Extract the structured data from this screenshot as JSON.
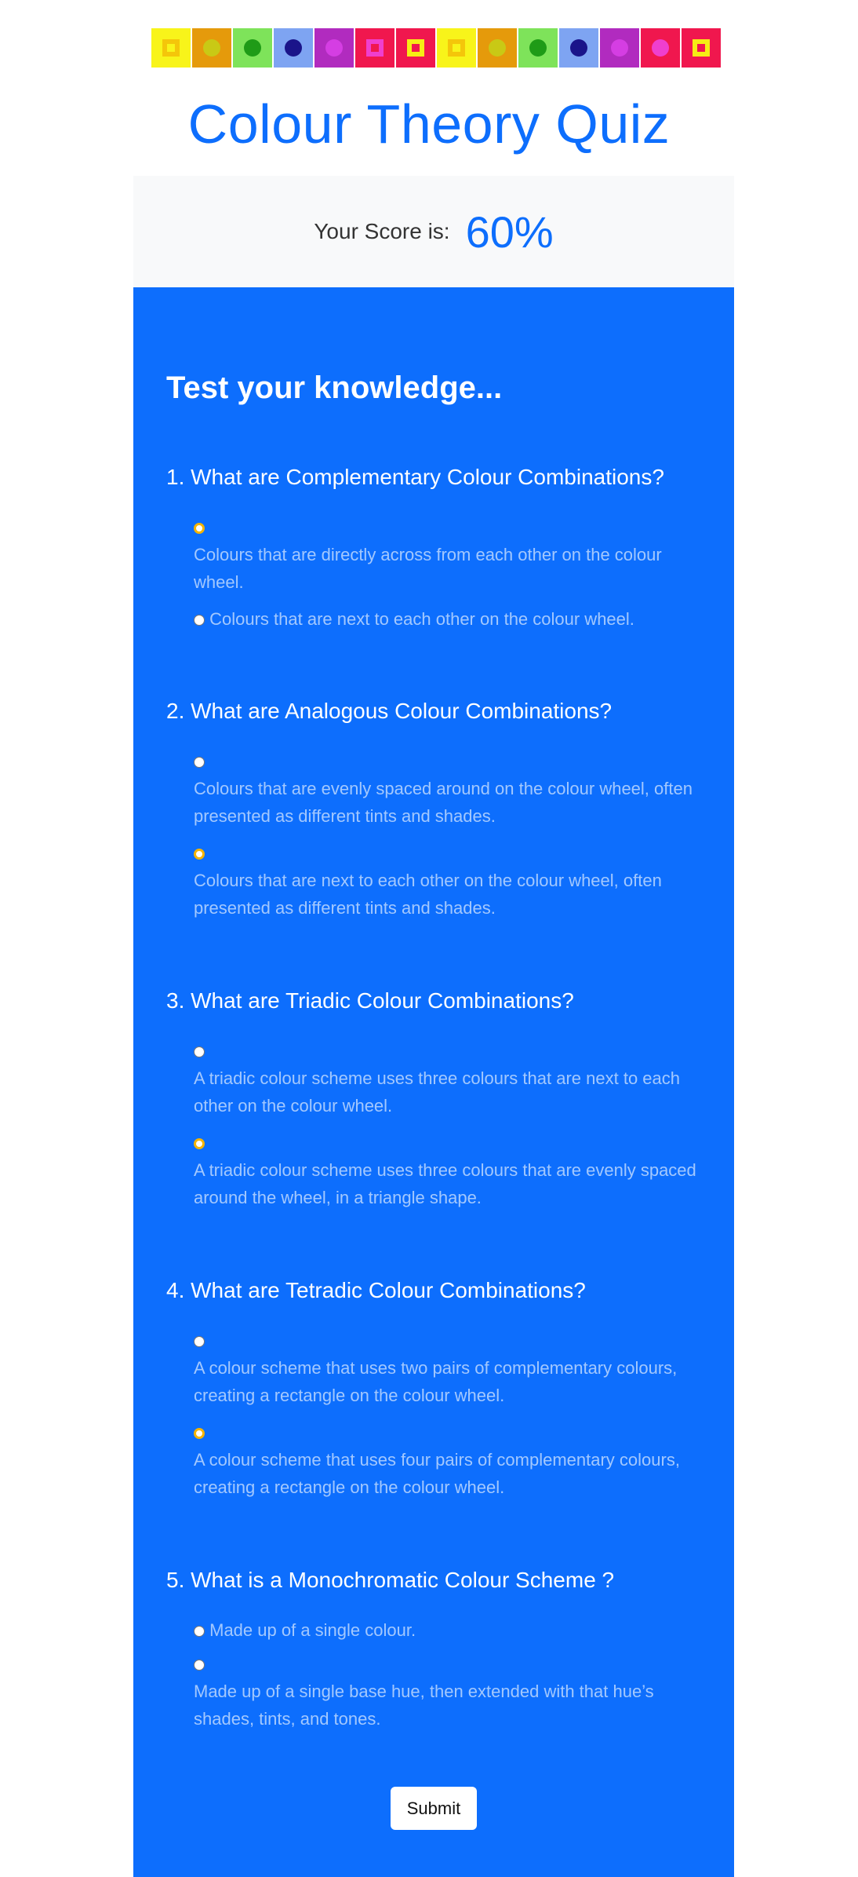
{
  "header": {
    "tiles": [
      {
        "bg": "#f8f41a",
        "inner": "#f4c60a",
        "shape": "sq",
        "name": "yellow-square-tile-icon"
      },
      {
        "bg": "#e59a0b",
        "inner": "#c9c915",
        "shape": "circ",
        "name": "orange-circle-tile-icon"
      },
      {
        "bg": "#7ee35a",
        "inner": "#1f9b17",
        "shape": "circ",
        "name": "green-circle-tile-icon"
      },
      {
        "bg": "#7ea4f2",
        "inner": "#1a148a",
        "shape": "circ",
        "name": "blue-circle-tile-icon"
      },
      {
        "bg": "#b12bbf",
        "inner": "#d53ee3",
        "shape": "circ",
        "name": "purple-circle-tile-icon"
      },
      {
        "bg": "#f0174e",
        "inner": "#ef3fcf",
        "shape": "sq",
        "name": "red-square-tile-icon"
      },
      {
        "bg": "#f0174e",
        "inner": "#f6ec15",
        "shape": "sq",
        "name": "red-yellow-square-tile-icon"
      },
      {
        "bg": "#f8f41a",
        "inner": "#f4c60a",
        "shape": "sq",
        "name": "yellow-square-tile-icon"
      },
      {
        "bg": "#e59a0b",
        "inner": "#c9c915",
        "shape": "circ",
        "name": "orange-circle-tile-icon"
      },
      {
        "bg": "#7ee35a",
        "inner": "#1f9b17",
        "shape": "circ",
        "name": "green-circle-tile-icon"
      },
      {
        "bg": "#7ea4f2",
        "inner": "#1a148a",
        "shape": "circ",
        "name": "blue-circle-tile-icon"
      },
      {
        "bg": "#b12bbf",
        "inner": "#d53ee3",
        "shape": "circ",
        "name": "purple-circle-tile-icon"
      },
      {
        "bg": "#f0174e",
        "inner": "#ef3fcf",
        "shape": "circ",
        "name": "red-circle-tile-icon"
      },
      {
        "bg": "#f0174e",
        "inner": "#f6ec15",
        "shape": "sq",
        "name": "red-yellow-square-tile-icon"
      }
    ],
    "title": "Colour Theory Quiz"
  },
  "score": {
    "label": "Your Score is:",
    "value": "60%"
  },
  "quiz": {
    "heading": "Test your knowledge...",
    "questions": [
      {
        "text": "1. What are Complementary Colour Combinations?",
        "options": [
          {
            "label": "Colours that are directly across from each other on the colour wheel.",
            "checked": true,
            "layout": "block"
          },
          {
            "label": "Colours that are next to each other on the colour wheel.",
            "checked": false,
            "layout": "inline"
          }
        ]
      },
      {
        "text": "2. What are Analogous Colour Combinations?",
        "options": [
          {
            "label": "Colours that are evenly spaced around on the colour wheel, often presented as different tints and shades.",
            "checked": false,
            "layout": "block"
          },
          {
            "label": "Colours that are next to each other on the colour wheel, often presented as different tints and shades.",
            "checked": true,
            "layout": "block"
          }
        ]
      },
      {
        "text": "3. What are Triadic Colour Combinations?",
        "options": [
          {
            "label": "A triadic colour scheme uses three colours that are next to each other on the colour wheel.",
            "checked": false,
            "layout": "block"
          },
          {
            "label": "A triadic colour scheme uses three colours that are evenly spaced around the wheel, in a triangle shape.",
            "checked": true,
            "layout": "block"
          }
        ]
      },
      {
        "text": "4. What are Tetradic Colour Combinations?",
        "options": [
          {
            "label": "A colour scheme that uses two pairs of complementary colours, creating a rectangle on the colour wheel.",
            "checked": false,
            "layout": "block"
          },
          {
            "label": "A colour scheme that uses four pairs of complementary colours, creating a rectangle on the colour wheel.",
            "checked": true,
            "layout": "block"
          }
        ]
      },
      {
        "text": "5. What is a Monochromatic Colour Scheme ?",
        "options": [
          {
            "label": "Made up of a single colour.",
            "checked": false,
            "layout": "inline"
          },
          {
            "label": "Made up of a single base hue, then extended with that hue’s shades, tints, and tones.",
            "checked": false,
            "layout": "block"
          }
        ]
      }
    ],
    "submit_label": "Submit"
  }
}
